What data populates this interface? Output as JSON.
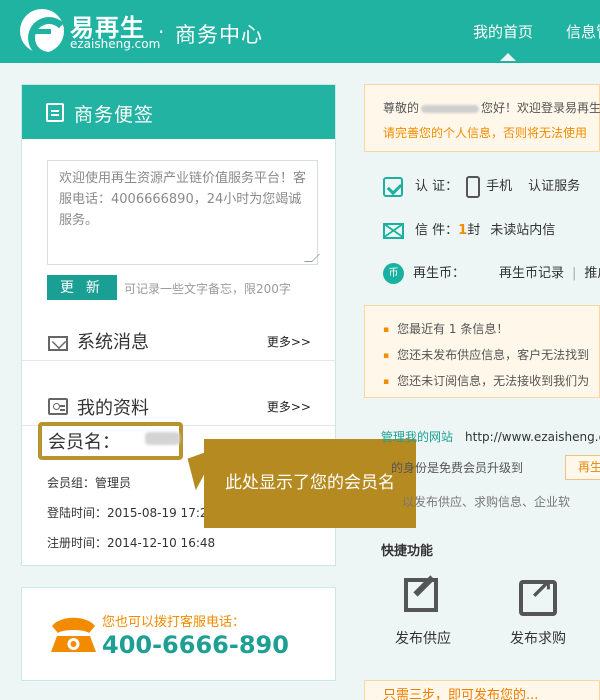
{
  "header": {
    "brand_cn": "易再生",
    "brand_en": "ezaisheng.com",
    "brand_dot": "·",
    "brand_center": "商务中心",
    "nav": [
      "我的首页",
      "信息管"
    ]
  },
  "left": {
    "memo_title": "商务便签",
    "memo_text": "欢迎使用再生资源产业链价值服务平台！客服电话：4006666890，24小时为您竭诚服务。",
    "update_button": "更 新",
    "memo_hint": "可记录一些文字备忘，限200字",
    "system_messages": "系统消息",
    "more_1": "更多>>",
    "my_profile": "我的资料",
    "more_2": "更多>>",
    "member_label": "会员名：",
    "member_group": "会员组：管理员",
    "login_time": "登陆时间：2015-08-19 17:20",
    "register_time": "注册时间：2014-12-10 16:48",
    "phone_hint": "您也可以拨打客服电话：",
    "phone_number": "400-6666-890"
  },
  "callout": {
    "text": "此处显示了您的会员名"
  },
  "right": {
    "welcome_prefix": "尊敬的",
    "welcome_suffix": "您好！欢迎登录易再生",
    "welcome_warning": "请完善您的个人信息，否则将无法使用",
    "auth_label": "认  证：",
    "auth_phone": "手机",
    "auth_service": "认证服务",
    "mail_label": "信  件：",
    "mail_count": "1",
    "mail_unit": "封",
    "mail_unread": "未读站内信",
    "coin_label": "再生币：",
    "coin_record": "再生币记录",
    "coin_sep": "|",
    "coin_promo": "推广",
    "messages": [
      "您最近有 1 条信息！",
      "您还未发布供应信息，客户无法找到",
      "您还未订阅信息，无法接收到我们为"
    ],
    "manage_site": "管理我的网站",
    "site_url": "http://www.ezaisheng.c",
    "upgrade_text": "的身份是免费会员升级到",
    "upgrade_button": "再生",
    "publish_text": "以发布供应、求购信息、企业软",
    "quick_title": "快捷功能",
    "quick_supply": "发布供应",
    "quick_purchase": "发布求购",
    "promo": "只需三步，即可发布您的..."
  }
}
